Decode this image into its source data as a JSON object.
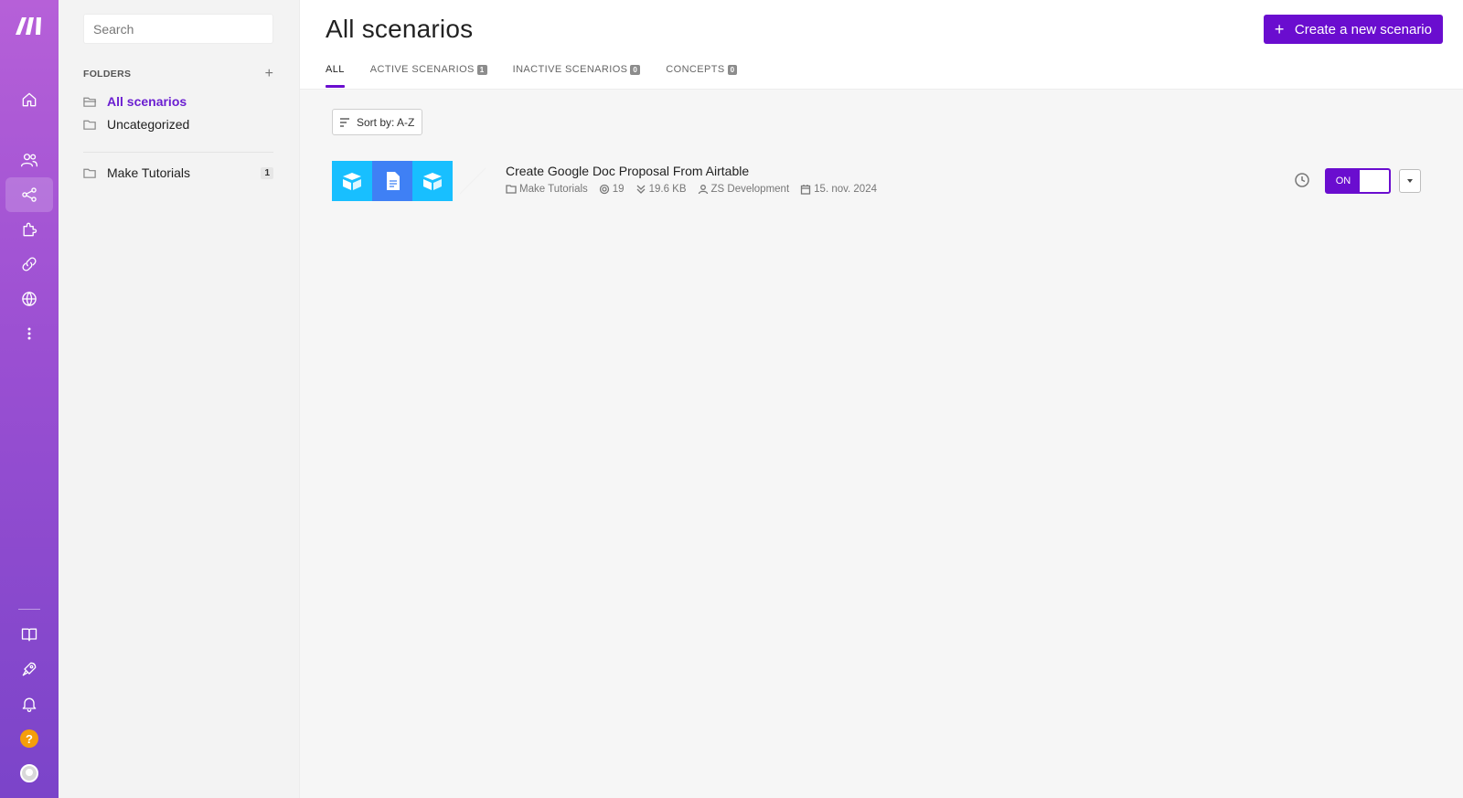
{
  "sidebar": {
    "logo": "make-logo",
    "nav_icons": [
      "home-icon",
      "team-icon",
      "scenarios-icon",
      "apps-icon",
      "connections-icon",
      "webhooks-icon",
      "more-icon"
    ],
    "bottom_icons": [
      "docs-icon",
      "rocket-icon",
      "bell-icon",
      "help-icon",
      "avatar"
    ],
    "help_glyph": "?"
  },
  "folders": {
    "search_placeholder": "Search",
    "header": "FOLDERS",
    "add_glyph": "+",
    "items": [
      {
        "label": "All scenarios",
        "active": true
      },
      {
        "label": "Uncategorized",
        "active": false
      },
      {
        "label": "Make Tutorials",
        "count": "1"
      }
    ]
  },
  "header": {
    "title": "All scenarios",
    "create_button": "Create a new scenario",
    "create_glyph": "+",
    "tabs": [
      {
        "label": "ALL",
        "active": true
      },
      {
        "label": "ACTIVE SCENARIOS",
        "badge": "1"
      },
      {
        "label": "INACTIVE SCENARIOS",
        "badge": "0"
      },
      {
        "label": "CONCEPTS",
        "badge": "0"
      }
    ],
    "accent": "#6a0dcf"
  },
  "toolbar": {
    "sort_label": "Sort by: A-Z"
  },
  "scenario": {
    "title": "Create Google Doc Proposal From Airtable",
    "folder": "Make Tutorials",
    "operations": "19",
    "data_size": "19.6 KB",
    "owner": "ZS Development",
    "date": "15. nov. 2024",
    "toggle_label": "ON",
    "apps": [
      "airtable",
      "google-docs",
      "airtable"
    ],
    "colors": {
      "airtable": "#18bfff",
      "google_docs": "#3f80f5"
    }
  }
}
